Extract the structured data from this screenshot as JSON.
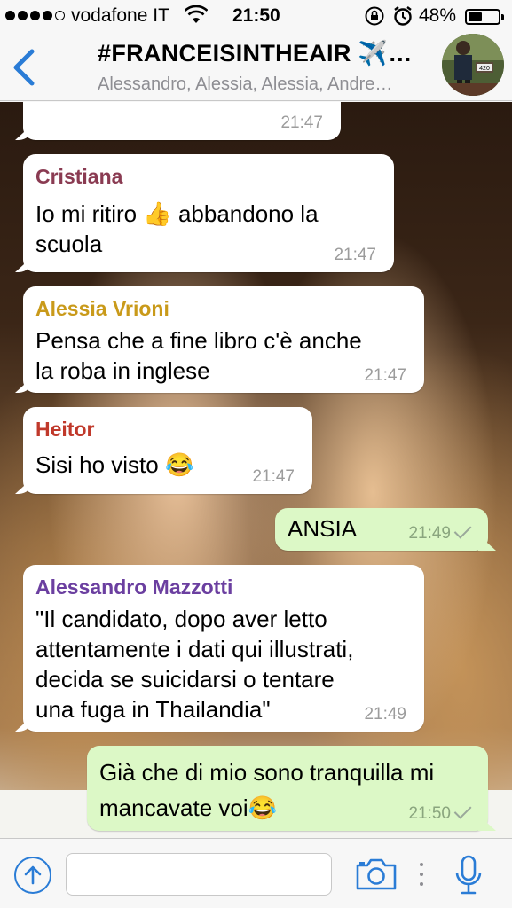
{
  "status_bar": {
    "carrier": "vodafone IT",
    "time": "21:50",
    "battery_percent": "48%",
    "battery_level": 0.48,
    "signal_bars": 4
  },
  "header": {
    "title": "#FRANCEISINTHEAIR ✈️…",
    "subtitle": "Alessandro, Alessia, Alessia, Andre…",
    "avatar_badge": "420",
    "back_icon": "chevron-left-icon"
  },
  "messages": [
    {
      "direction": "in",
      "sender": "",
      "text": "",
      "time": "21:47"
    },
    {
      "direction": "in",
      "sender": "Cristiana",
      "sender_color": "#8a3b52",
      "line1": "Io mi ritiro 👍 abbandono la",
      "line2": "scuola",
      "time": "21:47"
    },
    {
      "direction": "in",
      "sender": "Alessia Vrioni",
      "sender_color": "#c99a1a",
      "line1": "Pensa che a fine libro c'è anche",
      "line2": "la roba in inglese",
      "time": "21:47"
    },
    {
      "direction": "in",
      "sender": "Heitor",
      "sender_color": "#c0392b",
      "line1": "Sisi ho visto 😂",
      "time": "21:47"
    },
    {
      "direction": "out",
      "line1": "ANSIA",
      "time": "21:49"
    },
    {
      "direction": "in",
      "sender": "Alessandro Mazzotti",
      "sender_color": "#6b3fa0",
      "line1": "\"Il candidato, dopo aver letto",
      "line2": "attentamente i dati qui illustrati,",
      "line3": "decida se suicidarsi o tentare",
      "line4": "una fuga in Thailandia\"",
      "time": "21:49"
    },
    {
      "direction": "out",
      "line1": "Già che di mio sono tranquilla mi",
      "line2": "mancavate voi😂",
      "time": "21:50"
    }
  ],
  "input_bar": {
    "placeholder": "",
    "accent_color": "#2a7cd6"
  }
}
